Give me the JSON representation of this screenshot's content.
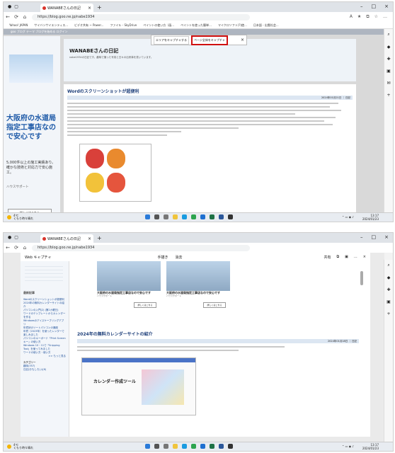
{
  "browser": {
    "tab_title": "WANABEさんの日記",
    "url": "https://blog.goo.ne.jp/nabe1934",
    "bookmarks": [
      "Yahoo! JAPAN",
      "サイバンサイエンティス...",
      "ビデオ共有 ~ Power...",
      "ファイル - SkyDrive",
      "ペイントの使い方（画...",
      "ペイントを使った簡単...",
      "マイクロソフト(?)使...",
      "日本語 - 出雲社会...",
      "日に通じるHAu...",
      "その他お気に入り"
    ]
  },
  "screenshot1": {
    "blog_top": "goo ブログ テーマ ブログを始める ログイン",
    "blog_title": "WANABEさんの日記",
    "blog_sub": "nabe1934の日記です。趣味で撮った写真と日々の出来事を書いています。",
    "capture": {
      "area_label": "エリアをキャプチャする",
      "full_label": "ページ全体をキャプチャ",
      "close": "×"
    },
    "ad": {
      "headline": "大阪府の水道局指定工事店なので安心です",
      "detail": "5,000件以上の施工実績あり。確かな技術と対応力で安心施工。",
      "company": "ハウスサポート",
      "button": "詳しくはこちら"
    },
    "article": {
      "title": "Wordのスクリーンショットが超便利",
      "date": "2024年01月21日 ｜ 日記"
    }
  },
  "screenshot2": {
    "webcapture": {
      "title": "Web キャプチャ",
      "draw": "手描き",
      "erase": "消去",
      "share": "共有"
    },
    "sidebar": {
      "recent_title": "最新記事",
      "links": [
        "Wordのスクリーンショットが超便利",
        "2024年の無料カレンダーサイトの紹介",
        "パソコンの入門(2) (第2カ曜日)",
        "ワードのテンプレートからカレンダーを作る",
        "Windowsのアイスケーブリングアプリ",
        "年賀状のソートパソコンの講座",
        "年賀（2023年）を使ったレンダーで楽しみました",
        "パソコンのキーボード「Print Screen キー」の使い方",
        "Windows 10・11で「Snipping Tool」を使ってみました",
        "ワードの使い方・使い方"
      ],
      "more": ">> もっと見る",
      "category_title": "カテゴリー",
      "categories": [
        "趣味(357)",
        "日記(おもしろい)(6)"
      ]
    },
    "promos": [
      {
        "title": "大阪府の水道局指定工事店なので安心です",
        "company": "ハウスサポート",
        "button": "詳しくはこちら"
      },
      {
        "title": "大阪府の水道局指定工事店なので安心です",
        "company": "ハウスサポート",
        "button": "詳しくはこちら"
      }
    ],
    "section_title": "2024年の無料カレンダーサイトの紹介",
    "section_date": "2024年01月18日 ｜ 日記",
    "calendar_title": "カレンダー作成ツール"
  },
  "taskbar": {
    "weather_temp": "4℃",
    "weather_desc": "くもり時々晴れ",
    "time": "13:17",
    "date": "2024/01/23"
  }
}
